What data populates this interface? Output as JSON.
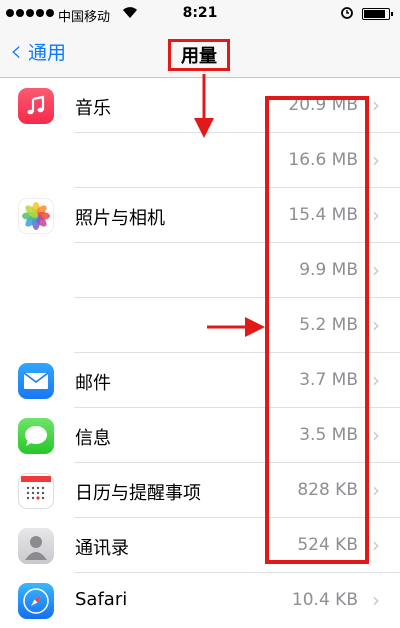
{
  "status_bar": {
    "carrier": "中国移动",
    "time": "8:21",
    "battery_level": 0.92
  },
  "nav": {
    "back_label": "通用",
    "title": "用量"
  },
  "apps": [
    {
      "name": "音乐",
      "size": "20.9 MB",
      "icon": "music-icon"
    },
    {
      "name": "",
      "size": "16.6 MB",
      "icon": "blank-icon"
    },
    {
      "name": "照片与相机",
      "size": "15.4 MB",
      "icon": "photos-icon"
    },
    {
      "name": "",
      "size": "9.9 MB",
      "icon": "blank-icon"
    },
    {
      "name": "",
      "size": "5.2 MB",
      "icon": "blank-icon"
    },
    {
      "name": "邮件",
      "size": "3.7 MB",
      "icon": "mail-icon"
    },
    {
      "name": "信息",
      "size": "3.5 MB",
      "icon": "messages-icon"
    },
    {
      "name": "日历与提醒事项",
      "size": "828 KB",
      "icon": "calendar-icon"
    },
    {
      "name": "通讯录",
      "size": "524 KB",
      "icon": "contacts-icon"
    },
    {
      "name": "Safari",
      "size": "10.4 KB",
      "icon": "safari-icon"
    }
  ],
  "annotation_color": "#e31919",
  "accent_color": "#0a7aff"
}
